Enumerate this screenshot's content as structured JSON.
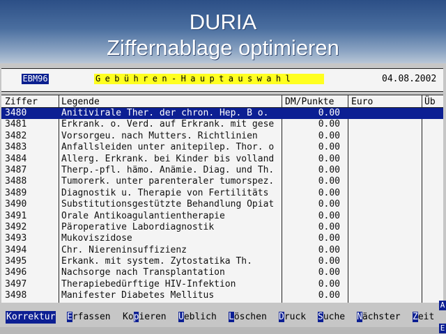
{
  "window": {
    "title": "DURIA",
    "subtitle": "Ziffernablage optimieren"
  },
  "header": {
    "catalog": "EBM96",
    "section": "Gebühren-Hauptauswahl",
    "date": "04.08.2002"
  },
  "table": {
    "columns": [
      "Ziffer",
      "Legende",
      "DM/Punkte",
      "Euro",
      "Üb"
    ],
    "rows": [
      {
        "ziffer": "3480",
        "legende": "Anitivirale Ther. der chron. Hep. B o.",
        "dm": "0.00",
        "selected": true
      },
      {
        "ziffer": "3481",
        "legende": "Erkrank. o. Verd. auf Erkrank. mit gese",
        "dm": "0.00",
        "selected": false
      },
      {
        "ziffer": "3482",
        "legende": "Vorsorgeu. nach Mutters. Richtlinien",
        "dm": "0.00",
        "selected": false
      },
      {
        "ziffer": "3483",
        "legende": "Anfallsleiden unter anitepilep. Thor. o",
        "dm": "0.00",
        "selected": false
      },
      {
        "ziffer": "3484",
        "legende": "Allerg. Erkrank. bei Kinder bis volland",
        "dm": "0.00",
        "selected": false
      },
      {
        "ziffer": "3487",
        "legende": "Therp.-pfl. hämo. Anämie. Diag. und Th.",
        "dm": "0.00",
        "selected": false
      },
      {
        "ziffer": "3488",
        "legende": "Tumorerk. unter parenteraler tumorspez.",
        "dm": "0.00",
        "selected": false
      },
      {
        "ziffer": "3489",
        "legende": "Diagnostik u. Therapie von Fertilitäts",
        "dm": "0.00",
        "selected": false
      },
      {
        "ziffer": "3490",
        "legende": "Substitutionsgestützte Behandlung Opiat",
        "dm": "0.00",
        "selected": false
      },
      {
        "ziffer": "3491",
        "legende": "Orale Antikoagulantientherapie",
        "dm": "0.00",
        "selected": false
      },
      {
        "ziffer": "3492",
        "legende": "Päroperative Labordiagnostik",
        "dm": "0.00",
        "selected": false
      },
      {
        "ziffer": "3493",
        "legende": "Mukoviszidose",
        "dm": "0.00",
        "selected": false
      },
      {
        "ziffer": "3494",
        "legende": "Chr. Niereninsuffizienz",
        "dm": "0.00",
        "selected": false
      },
      {
        "ziffer": "3495",
        "legende": "Erkank. mit system. Zytostatika Th.",
        "dm": "0.00",
        "selected": false
      },
      {
        "ziffer": "3496",
        "legende": "Nachsorge nach Transplantation",
        "dm": "0.00",
        "selected": false
      },
      {
        "ziffer": "3497",
        "legende": "Therapiebedürftige HIV-Infektion",
        "dm": "0.00",
        "selected": false
      },
      {
        "ziffer": "3498",
        "legende": "Manifester Diabetes Mellitus",
        "dm": "0.00",
        "selected": false
      }
    ]
  },
  "menu": {
    "items": [
      {
        "key": "",
        "rest": "Korrektur",
        "full": "Korrektur",
        "active": true
      },
      {
        "key": "E",
        "rest": "rfassen",
        "full": "Erfassen",
        "active": false
      },
      {
        "key": "",
        "rest": "",
        "full": "Kopieren",
        "active": false,
        "pre": "Ko",
        "mid": "p",
        "post": "ieren"
      },
      {
        "key": "U",
        "rest": "eblich",
        "full": "Ueblich",
        "active": false
      },
      {
        "key": "L",
        "rest": "öschen",
        "full": "Löschen",
        "active": false
      },
      {
        "key": "D",
        "rest": "ruck",
        "full": "Druck",
        "active": false
      },
      {
        "key": "S",
        "rest": "uche",
        "full": "Suche",
        "active": false
      },
      {
        "key": "N",
        "rest": "ächster",
        "full": "Nächster",
        "active": false
      },
      {
        "key": "Z",
        "rest": "eit",
        "full": "Zeit",
        "active": false
      }
    ],
    "scroll_top": "A",
    "scroll_bottom": "E"
  },
  "colors": {
    "selection": "#0c1f93",
    "highlight_yellow": "#ffff20",
    "title_gradient_top": "#2c4f86"
  }
}
